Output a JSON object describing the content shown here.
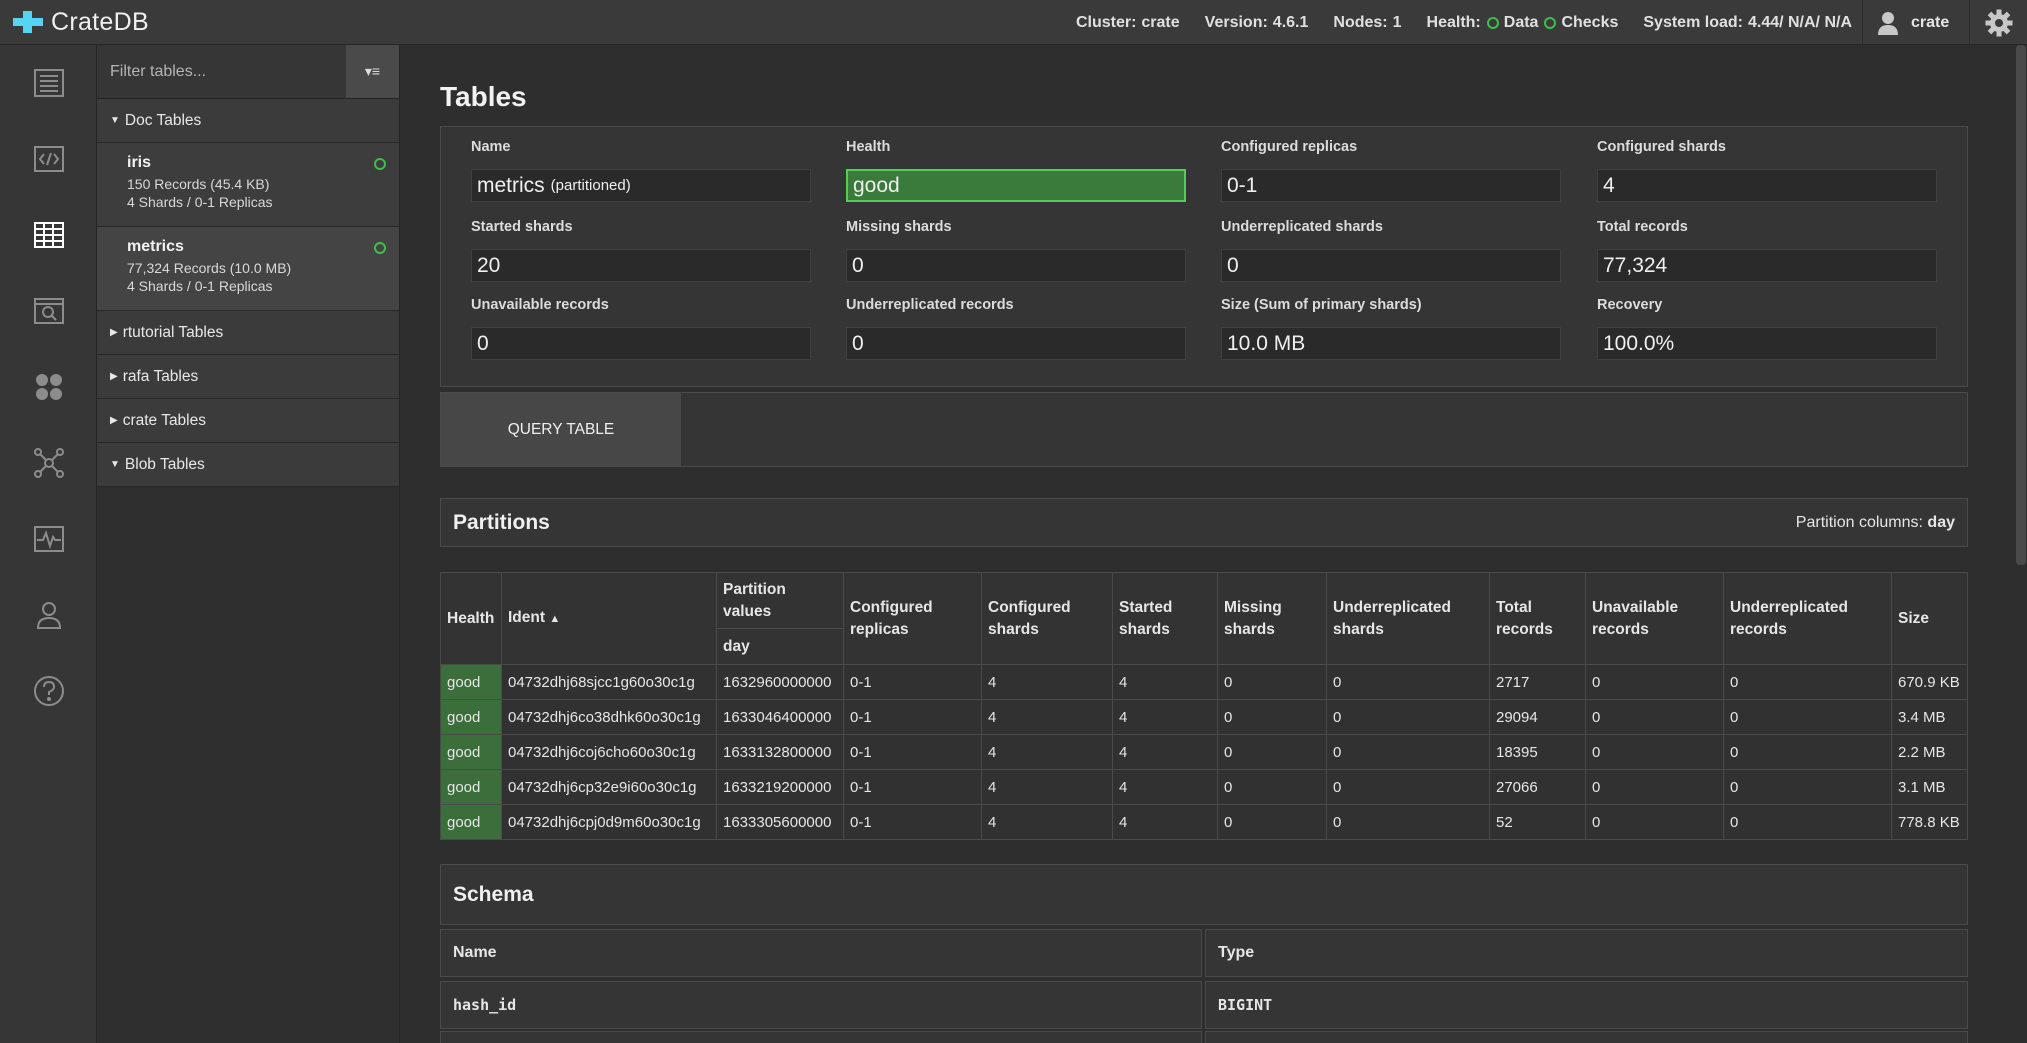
{
  "app": {
    "logo_text": "CrateDB"
  },
  "header": {
    "cluster_label": "Cluster:",
    "cluster_value": "crate",
    "version_label": "Version:",
    "version_value": "4.6.1",
    "nodes_label": "Nodes:",
    "nodes_value": "1",
    "health_label": "Health:",
    "health_data": "Data",
    "health_checks": "Checks",
    "load_label": "System load:",
    "load_value": "4.44/ N/A/ N/A",
    "user": "crate"
  },
  "rail": {
    "icons": [
      "overview-icon",
      "console-icon",
      "tables-icon",
      "views-icon",
      "cluster-icon",
      "nodes-graph-icon",
      "monitoring-icon",
      "users-icon",
      "help-icon"
    ],
    "active": "tables-icon"
  },
  "tablenav": {
    "filter_placeholder": "Filter tables...",
    "filter_button": "▾≡",
    "doc_group": "Doc Tables",
    "tables": [
      {
        "name": "iris",
        "records": "150 Records (45.4 KB)",
        "shards": "4 Shards / 0-1 Replicas"
      },
      {
        "name": "metrics",
        "records": "77,324 Records (10.0 MB)",
        "shards": "4 Shards / 0-1 Replicas"
      }
    ],
    "groups": [
      "rtutorial Tables",
      "rafa Tables",
      "crate Tables",
      "Blob Tables"
    ]
  },
  "main": {
    "title": "Tables",
    "fields": {
      "name_label": "Name",
      "name_value": "metrics",
      "name_suffix": "(partitioned)",
      "health_label": "Health",
      "health_value": "good",
      "replicas_label": "Configured replicas",
      "replicas_value": "0-1",
      "shards_label": "Configured shards",
      "shards_value": "4",
      "started_label": "Started shards",
      "started_value": "20",
      "missing_label": "Missing shards",
      "missing_value": "0",
      "under_label": "Underreplicated shards",
      "under_value": "0",
      "total_label": "Total records",
      "total_value": "77,324",
      "unavail_label": "Unavailable records",
      "unavail_value": "0",
      "underrec_label": "Underreplicated records",
      "underrec_value": "0",
      "size_label": "Size (Sum of primary shards)",
      "size_value": "10.0 MB",
      "recovery_label": "Recovery",
      "recovery_value": "100.0%"
    },
    "query_button": "QUERY TABLE",
    "partitions": {
      "title": "Partitions",
      "columns_label": "Partition columns:",
      "columns_value": "day",
      "headers": {
        "health": "Health",
        "ident": "Ident",
        "pvalues": "Partition values",
        "day": "day",
        "replicas": "Configured replicas",
        "cshards": "Configured shards",
        "sshards": "Started shards",
        "mshards": "Missing shards",
        "ushards": "Underreplicated shards",
        "trecords": "Total records",
        "urecords": "Unavailable records",
        "urrecords": "Underreplicated records",
        "size": "Size"
      },
      "rows": [
        [
          "good",
          "04732dhj68sjcc1g60o30c1g",
          "1632960000000",
          "0-1",
          "4",
          "4",
          "0",
          "0",
          "2717",
          "0",
          "0",
          "670.9 KB"
        ],
        [
          "good",
          "04732dhj6co38dhk60o30c1g",
          "1633046400000",
          "0-1",
          "4",
          "4",
          "0",
          "0",
          "29094",
          "0",
          "0",
          "3.4 MB"
        ],
        [
          "good",
          "04732dhj6coj6cho60o30c1g",
          "1633132800000",
          "0-1",
          "4",
          "4",
          "0",
          "0",
          "18395",
          "0",
          "0",
          "2.2 MB"
        ],
        [
          "good",
          "04732dhj6cp32e9i60o30c1g",
          "1633219200000",
          "0-1",
          "4",
          "4",
          "0",
          "0",
          "27066",
          "0",
          "0",
          "3.1 MB"
        ],
        [
          "good",
          "04732dhj6cpj0d9m60o30c1g",
          "1633305600000",
          "0-1",
          "4",
          "4",
          "0",
          "0",
          "52",
          "0",
          "0",
          "778.8 KB"
        ]
      ]
    },
    "schema": {
      "title": "Schema",
      "name_header": "Name",
      "type_header": "Type",
      "rows": [
        {
          "name": "hash_id",
          "type": "BIGINT"
        }
      ]
    }
  },
  "colors": {
    "accent": "#55d4f5",
    "health_ok": "#3dbf4a",
    "good_bg": "#3b6e3b"
  }
}
